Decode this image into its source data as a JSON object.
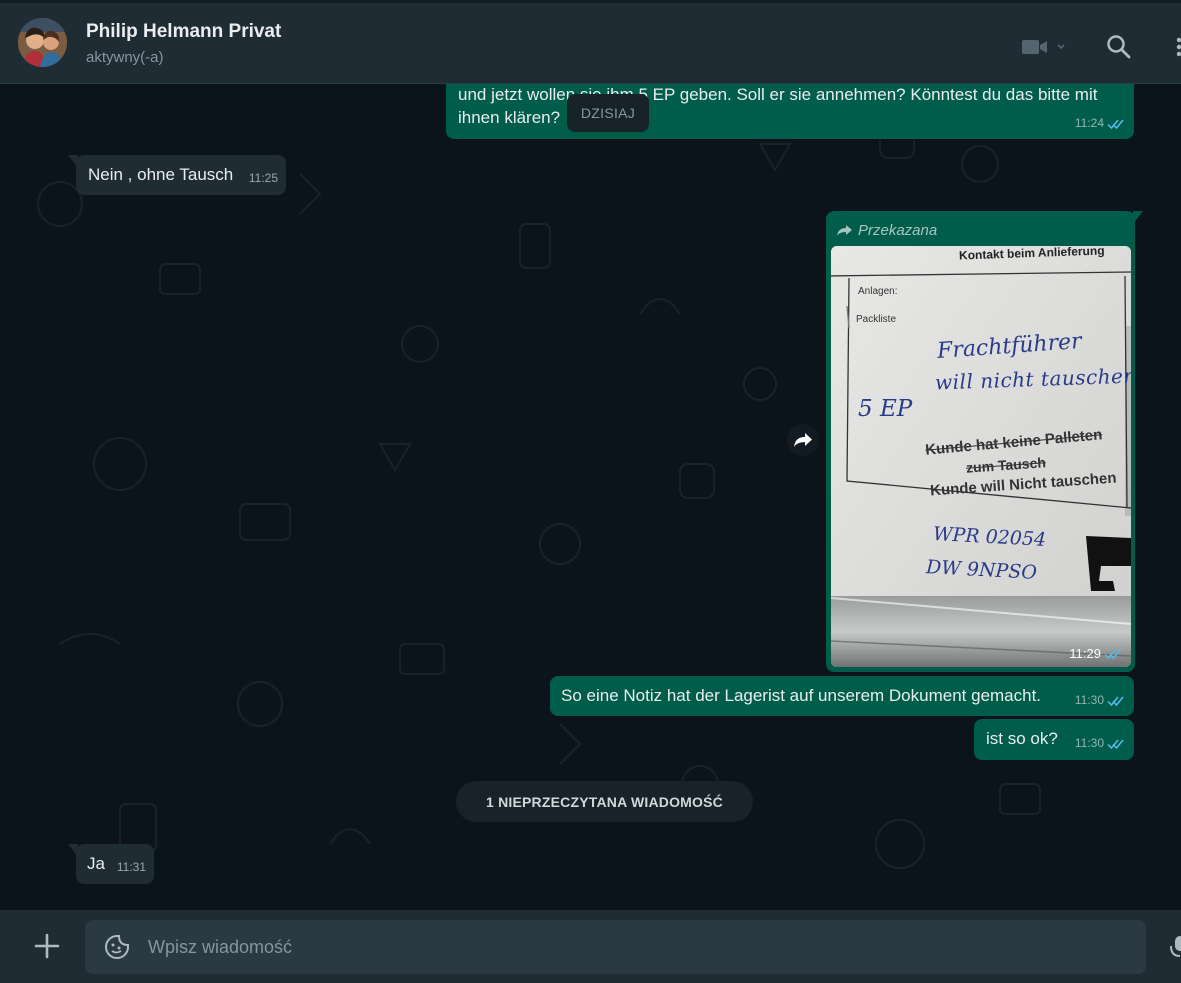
{
  "header": {
    "contact_name": "Philip Helmann Privat",
    "status": "aktywny(-a)",
    "icons": [
      "video-call-icon",
      "chevron-down-icon",
      "search-icon",
      "menu-icon"
    ]
  },
  "chat": {
    "day_divider": "DZISIAJ",
    "messages": [
      {
        "direction": "outgoing",
        "text_line1": "und jetzt wollen sie ihm 5 EP geben. Soll er sie annehmen? Könntest du das bitte mit",
        "text_line2": "ihnen klären?",
        "time": "11:24",
        "status": "read"
      },
      {
        "direction": "incoming",
        "text": "Nein , ohne Tausch",
        "time": "11:25"
      },
      {
        "direction": "outgoing",
        "type": "photo",
        "forwarded_label": "Przekazana",
        "time": "11:29",
        "status": "read",
        "photo_text": {
          "print_top": "Kontakt beim Anlieferung",
          "print_anlagen": "Anlagen:",
          "print_packliste": "Packliste",
          "hand_line1": "Frachtführer",
          "hand_line2": "will nicht tauschen",
          "hand_5ep": "5 EP",
          "hand_kunde1": "Kunde hat keine Palleten",
          "hand_zum": "zum Tausch",
          "hand_kunde2": "Kunde will Nicht tauschen",
          "hand_wpr": "WPR 02054",
          "hand_dw": "DW 9NPSO"
        }
      },
      {
        "direction": "outgoing",
        "text": "So eine Notiz hat der Lagerist auf unserem Dokument gemacht.",
        "time": "11:30",
        "status": "read"
      },
      {
        "direction": "outgoing",
        "text": "ist so ok?",
        "time": "11:30",
        "status": "read"
      },
      {
        "direction": "incoming",
        "text": "Ja",
        "time": "11:31"
      }
    ],
    "unread_divider": "1 NIEPRZECZYTANA WIADOMOŚĆ"
  },
  "composer": {
    "placeholder": "Wpisz wiadomość",
    "icons": [
      "plus-icon",
      "sticker-icon",
      "microphone-icon"
    ]
  },
  "colors": {
    "outgoing_bubble": "#005c4b",
    "incoming_bubble": "#202c33",
    "background": "#0b141a",
    "read_ticks": "#53bdeb"
  }
}
